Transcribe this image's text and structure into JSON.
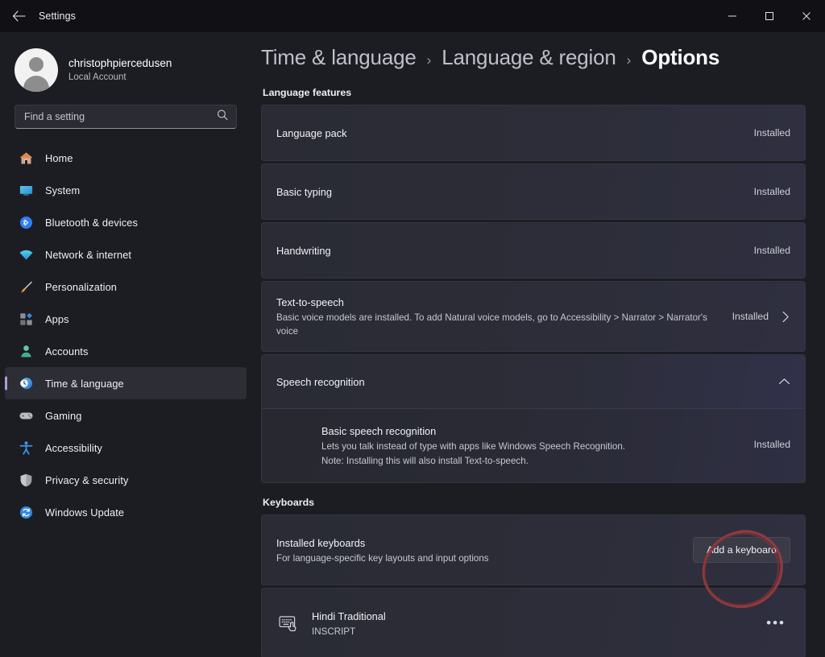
{
  "titlebar": {
    "back_icon": "arrow-left-icon",
    "title": "Settings",
    "minimize": "–",
    "maximize": "□",
    "close": "✕"
  },
  "account": {
    "name": "christophpiercedusen",
    "type": "Local Account"
  },
  "search": {
    "placeholder": "Find a setting",
    "value": "",
    "icon": "search-icon"
  },
  "sidebar": {
    "items": [
      {
        "label": "Home",
        "icon": "home-icon",
        "selected": false
      },
      {
        "label": "System",
        "icon": "system-icon",
        "selected": false
      },
      {
        "label": "Bluetooth & devices",
        "icon": "bluetooth-icon",
        "selected": false
      },
      {
        "label": "Network & internet",
        "icon": "network-icon",
        "selected": false
      },
      {
        "label": "Personalization",
        "icon": "paintbrush-icon",
        "selected": false
      },
      {
        "label": "Apps",
        "icon": "apps-icon",
        "selected": false
      },
      {
        "label": "Accounts",
        "icon": "accounts-icon",
        "selected": false
      },
      {
        "label": "Time & language",
        "icon": "clock-globe-icon",
        "selected": true
      },
      {
        "label": "Gaming",
        "icon": "gamepad-icon",
        "selected": false
      },
      {
        "label": "Accessibility",
        "icon": "accessibility-icon",
        "selected": false
      },
      {
        "label": "Privacy & security",
        "icon": "shield-icon",
        "selected": false
      },
      {
        "label": "Windows Update",
        "icon": "update-icon",
        "selected": false
      }
    ]
  },
  "breadcrumb": {
    "items": [
      "Time & language",
      "Language & region",
      "Options"
    ],
    "separator": "›"
  },
  "language_features": {
    "heading": "Language features",
    "items": [
      {
        "title": "Language pack",
        "desc": "",
        "status": "Installed",
        "chevron": ""
      },
      {
        "title": "Basic typing",
        "desc": "",
        "status": "Installed",
        "chevron": ""
      },
      {
        "title": "Handwriting",
        "desc": "",
        "status": "Installed",
        "chevron": ""
      },
      {
        "title": "Text-to-speech",
        "desc": "Basic voice models are installed. To add Natural voice models, go to Accessibility > Narrator > Narrator's voice",
        "status": "Installed",
        "chevron": "chevron-right-icon"
      }
    ],
    "speech_recognition": {
      "title": "Speech recognition",
      "chevron": "chevron-up-icon",
      "expanded": true,
      "child": {
        "title": "Basic speech recognition",
        "desc_line1": "Lets you talk instead of type with apps like Windows Speech Recognition.",
        "desc_line2": "Note: Installing this will also install Text-to-speech.",
        "status": "Installed"
      }
    }
  },
  "keyboards": {
    "heading": "Keyboards",
    "installed": {
      "title": "Installed keyboards",
      "desc": "For language-specific key layouts and input options",
      "button_label": "Add a keyboard"
    },
    "list": [
      {
        "name": "Hindi Traditional",
        "sub": "INSCRIPT",
        "icon": "keyboard-icon",
        "more": "•••"
      }
    ]
  },
  "annotation": {
    "shape": "red-ellipse-highlight",
    "color": "#8f3a3f",
    "target": "Add a keyboard"
  }
}
